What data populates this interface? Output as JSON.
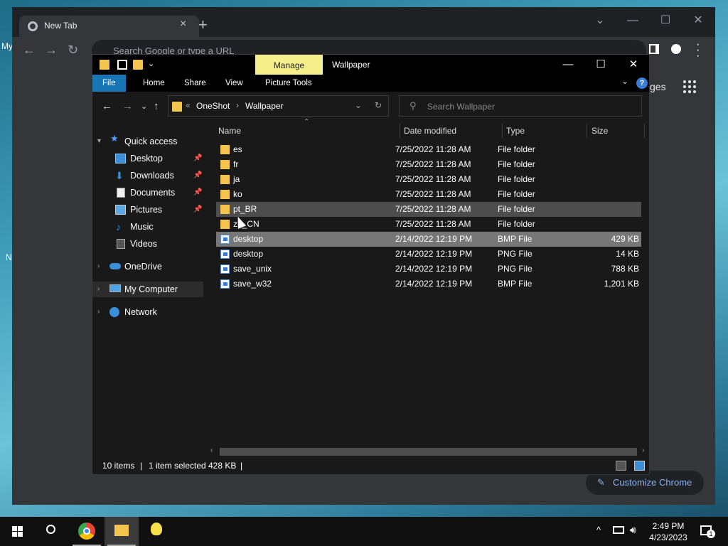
{
  "desktop": {
    "left_text_1": "My",
    "left_text_2": "N"
  },
  "chrome": {
    "tab_title": "New Tab",
    "tab_close": "×",
    "new_tab": "+",
    "window_controls": {
      "dropdown": "⌄",
      "minimize": "—",
      "maximize": "☐",
      "close": "✕"
    },
    "nav": {
      "back": "←",
      "forward": "→",
      "reload": "↻"
    },
    "omnibox_placeholder": "Search Google or type a URL",
    "images_link": "ges",
    "customize_label": "Customize Chrome",
    "customize_icon": "✎"
  },
  "explorer": {
    "manage_label": "Manage",
    "window_title": "Wallpaper",
    "window_controls": {
      "minimize": "—",
      "maximize": "☐",
      "close": "✕"
    },
    "ribbon_tabs": [
      "File",
      "Home",
      "Share",
      "View",
      "Picture Tools"
    ],
    "help": "?",
    "ribbon_collapse": "⌄",
    "nav_buttons": {
      "back": "←",
      "forward": "→",
      "recent": "⌄",
      "up": "↑"
    },
    "address": {
      "prefix": "«",
      "crumbs": [
        "OneShot",
        "Wallpaper"
      ],
      "sep": "›",
      "dropdown": "⌄",
      "refresh": "↻"
    },
    "search_placeholder": "Search Wallpaper",
    "search_icon": "⚲",
    "nav_pane": [
      {
        "label": "Quick access",
        "icon": "star-icon",
        "expanded": true
      },
      {
        "label": "Desktop",
        "icon": "desktop-icon",
        "pinned": true
      },
      {
        "label": "Downloads",
        "icon": "download-icon",
        "pinned": true
      },
      {
        "label": "Documents",
        "icon": "documents-icon",
        "pinned": true
      },
      {
        "label": "Pictures",
        "icon": "pictures-icon",
        "pinned": true
      },
      {
        "label": "Music",
        "icon": "music-icon"
      },
      {
        "label": "Videos",
        "icon": "videos-icon"
      },
      {
        "label": "OneDrive",
        "icon": "cloud-icon"
      },
      {
        "label": "My Computer",
        "icon": "computer-icon",
        "selected": true
      },
      {
        "label": "Network",
        "icon": "network-icon"
      }
    ],
    "columns": [
      "Name",
      "Date modified",
      "Type",
      "Size"
    ],
    "files": [
      {
        "name": "es",
        "date": "7/25/2022 11:28 AM",
        "type": "File folder",
        "size": "",
        "kind": "folder"
      },
      {
        "name": "fr",
        "date": "7/25/2022 11:28 AM",
        "type": "File folder",
        "size": "",
        "kind": "folder"
      },
      {
        "name": "ja",
        "date": "7/25/2022 11:28 AM",
        "type": "File folder",
        "size": "",
        "kind": "folder"
      },
      {
        "name": "ko",
        "date": "7/25/2022 11:28 AM",
        "type": "File folder",
        "size": "",
        "kind": "folder"
      },
      {
        "name": "pt_BR",
        "date": "7/25/2022 11:28 AM",
        "type": "File folder",
        "size": "",
        "kind": "folder",
        "hover": true
      },
      {
        "name": "zh_CN",
        "date": "7/25/2022 11:28 AM",
        "type": "File folder",
        "size": "",
        "kind": "folder"
      },
      {
        "name": "desktop",
        "date": "2/14/2022 12:19 PM",
        "type": "BMP File",
        "size": "429 KB",
        "kind": "file",
        "selected": true
      },
      {
        "name": "desktop",
        "date": "2/14/2022 12:19 PM",
        "type": "PNG File",
        "size": "14 KB",
        "kind": "file"
      },
      {
        "name": "save_unix",
        "date": "2/14/2022 12:19 PM",
        "type": "PNG File",
        "size": "788 KB",
        "kind": "file"
      },
      {
        "name": "save_w32",
        "date": "2/14/2022 12:19 PM",
        "type": "BMP File",
        "size": "1,201 KB",
        "kind": "file"
      }
    ],
    "status": {
      "items": "10 items",
      "selected": "1 item selected",
      "size": "428 KB",
      "bar": "|"
    }
  },
  "taskbar": {
    "time": "2:49 PM",
    "date": "4/23/2023",
    "notification_count": "1",
    "tray_chevron": "^"
  }
}
